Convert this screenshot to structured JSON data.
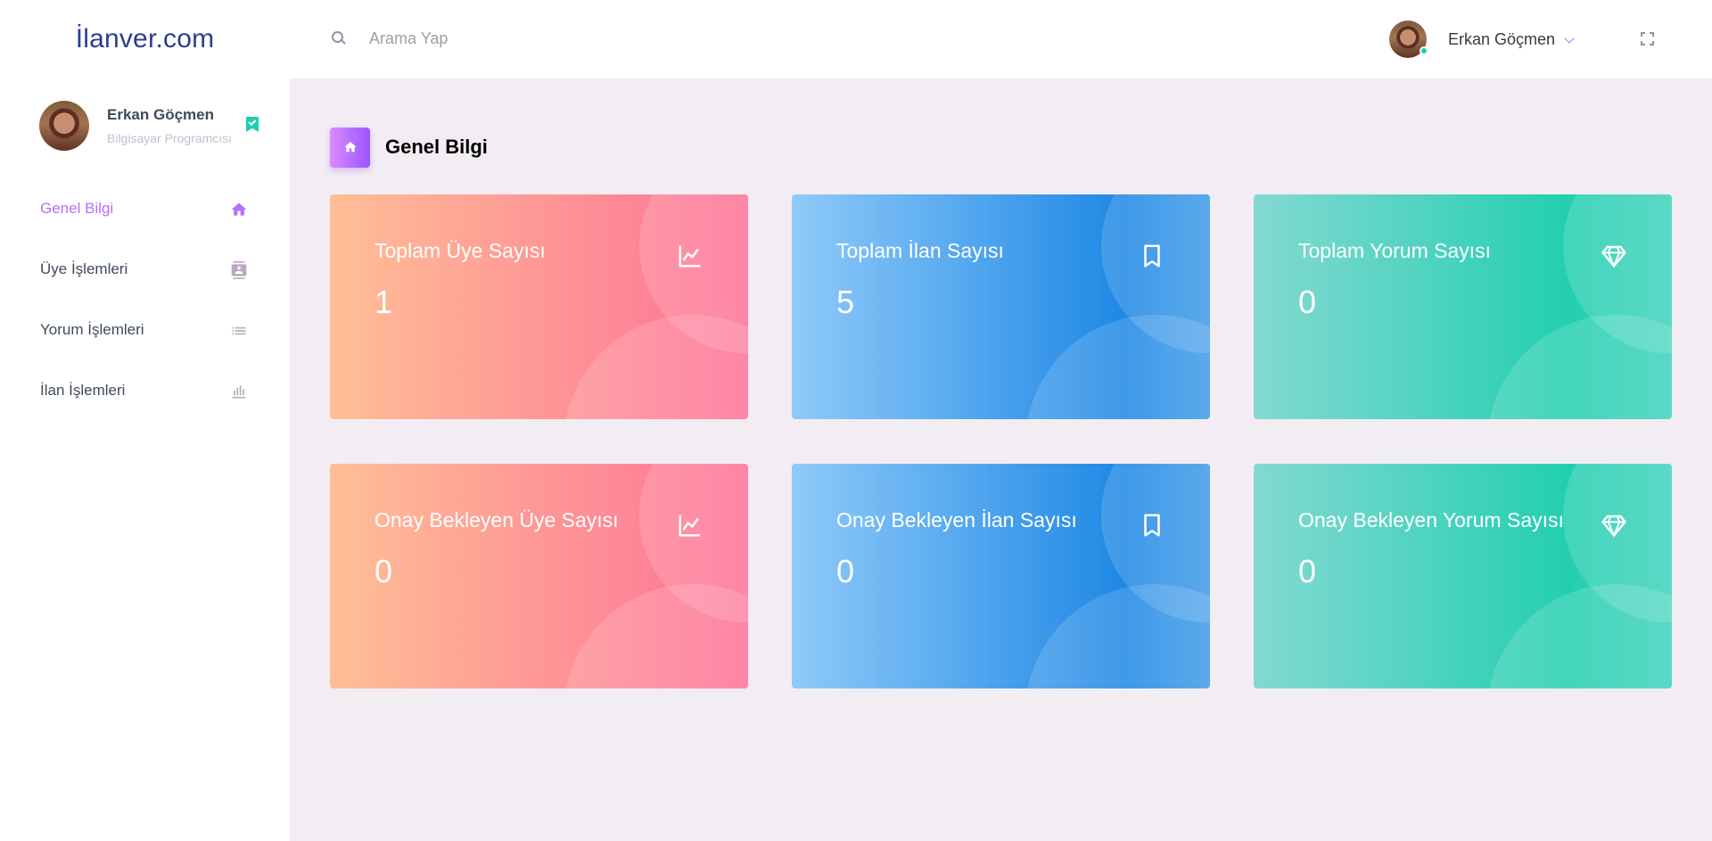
{
  "brand": {
    "name": "İlanver.com"
  },
  "search": {
    "placeholder": "Arama Yap"
  },
  "navbar": {
    "user_name": "Erkan Göçmen"
  },
  "sidebar": {
    "profile": {
      "name": "Erkan Göçmen",
      "role": "Bilgisayar Programcısı"
    },
    "items": [
      {
        "label": "Genel Bilgi",
        "icon": "home-icon",
        "active": true
      },
      {
        "label": "Üye İşlemleri",
        "icon": "contacts-icon",
        "active": false
      },
      {
        "label": "Yorum İşlemleri",
        "icon": "list-icon",
        "active": false
      },
      {
        "label": "İlan İşlemleri",
        "icon": "bar-chart-icon",
        "active": false
      }
    ]
  },
  "page": {
    "title": "Genel Bilgi",
    "icon": "home-icon"
  },
  "cards": [
    {
      "title": "Toplam Üye Sayısı",
      "value": "1",
      "icon": "chart-line-icon",
      "gradient": [
        "#ffbf96",
        "#fe7096"
      ]
    },
    {
      "title": "Toplam İlan Sayısı",
      "value": "5",
      "icon": "bookmark-icon",
      "gradient": [
        "#90caf9",
        "#047edf"
      ]
    },
    {
      "title": "Toplam Yorum Sayısı",
      "value": "0",
      "icon": "diamond-icon",
      "gradient": [
        "#84d9d2",
        "#07cdae"
      ]
    },
    {
      "title": "Onay Bekleyen Üye Sayısı",
      "value": "0",
      "icon": "chart-line-icon",
      "gradient": [
        "#ffbf96",
        "#fe7096"
      ]
    },
    {
      "title": "Onay Bekleyen İlan Sayısı",
      "value": "0",
      "icon": "bookmark-icon",
      "gradient": [
        "#90caf9",
        "#047edf"
      ]
    },
    {
      "title": "Onay Bekleyen Yorum Sayısı",
      "value": "0",
      "icon": "diamond-icon",
      "gradient": [
        "#84d9d2",
        "#07cdae"
      ]
    }
  ],
  "colors": {
    "accent": "#b66dff",
    "status_online": "#1bcfb4",
    "background": "#f2edf3"
  }
}
